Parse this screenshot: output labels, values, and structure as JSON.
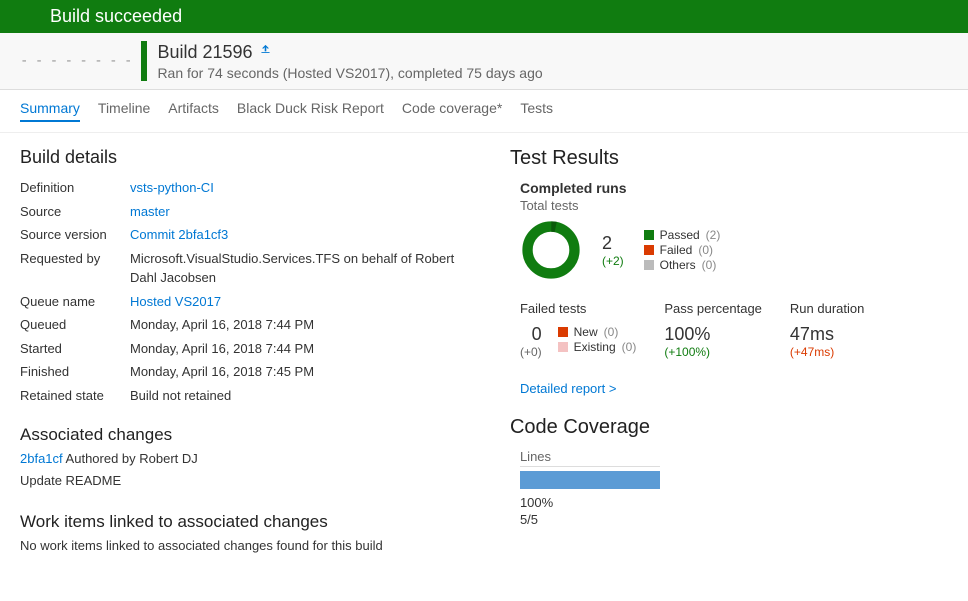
{
  "banner": {
    "text": "Build succeeded"
  },
  "header": {
    "title": "Build 21596",
    "subtitle": "Ran for 74 seconds (Hosted VS2017), completed 75 days ago"
  },
  "tabs": [
    "Summary",
    "Timeline",
    "Artifacts",
    "Black Duck Risk Report",
    "Code coverage*",
    "Tests"
  ],
  "buildDetails": {
    "heading": "Build details",
    "rows": {
      "definition": {
        "label": "Definition",
        "value": "vsts-python-CI"
      },
      "source": {
        "label": "Source",
        "value": "master"
      },
      "sourceVersion": {
        "label": "Source version",
        "value": "Commit 2bfa1cf3"
      },
      "requestedBy": {
        "label": "Requested by",
        "value": "Microsoft.VisualStudio.Services.TFS on behalf of Robert Dahl Jacobsen"
      },
      "queueName": {
        "label": "Queue name",
        "value": "Hosted VS2017"
      },
      "queued": {
        "label": "Queued",
        "value": "Monday, April 16, 2018 7:44 PM"
      },
      "started": {
        "label": "Started",
        "value": "Monday, April 16, 2018 7:44 PM"
      },
      "finished": {
        "label": "Finished",
        "value": "Monday, April 16, 2018 7:45 PM"
      },
      "retained": {
        "label": "Retained state",
        "value": "Build not retained"
      }
    }
  },
  "associated": {
    "heading": "Associated changes",
    "commit": "2bfa1cf",
    "authoredBy": " Authored by Robert DJ",
    "message": "Update README"
  },
  "workItems": {
    "heading": "Work items linked to associated changes",
    "empty": "No work items linked to associated changes found for this build"
  },
  "testResults": {
    "heading": "Test Results",
    "completedRuns": "Completed runs",
    "totalTests": "Total tests",
    "totalValue": "2",
    "totalDelta": "(+2)",
    "legend": {
      "passed": {
        "label": "Passed",
        "count": "(2)"
      },
      "failed": {
        "label": "Failed",
        "count": "(0)"
      },
      "others": {
        "label": "Others",
        "count": "(0)"
      }
    },
    "failedTests": {
      "label": "Failed tests",
      "value": "0",
      "delta": "(+0)"
    },
    "failedLegend": {
      "new": {
        "label": "New",
        "count": "(0)"
      },
      "existing": {
        "label": "Existing",
        "count": "(0)"
      }
    },
    "passPct": {
      "label": "Pass percentage",
      "value": "100%",
      "delta": "(+100%)"
    },
    "duration": {
      "label": "Run duration",
      "value": "47ms",
      "delta": "(+47ms)"
    },
    "detailedReport": "Detailed report >"
  },
  "coverage": {
    "heading": "Code Coverage",
    "linesLabel": "Lines",
    "pct": "100%",
    "ratio": "5/5"
  }
}
